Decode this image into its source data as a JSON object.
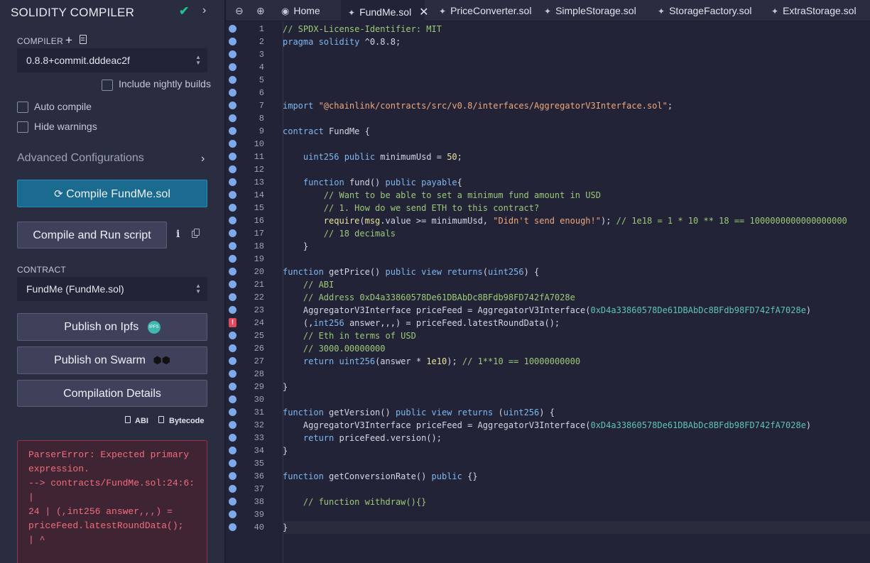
{
  "side_panel": {
    "title": "SOLIDITY COMPILER",
    "compiler_label": "COMPILER",
    "compiler_version": "0.8.8+commit.dddeac2f",
    "nightly_label": "Include nightly builds",
    "auto_compile_label": "Auto compile",
    "hide_warnings_label": "Hide warnings",
    "advanced_label": "Advanced Configurations",
    "compile_button": "Compile FundMe.sol",
    "compile_run_button": "Compile and Run script",
    "contract_label": "CONTRACT",
    "contract_value": "FundMe (FundMe.sol)",
    "publish_ipfs": "Publish on Ipfs",
    "ipfs_badge": "IPFS",
    "publish_swarm": "Publish on Swarm",
    "compilation_details": "Compilation Details",
    "abi_label": "ABI",
    "bytecode_label": "Bytecode",
    "error_lines": [
      "ParserError: Expected primary expression.",
      "--> contracts/FundMe.sol:24:6:",
      "|",
      "24 | (,int256 answer,,,) = priceFeed.latestRoundData();",
      "| ^"
    ]
  },
  "tabs": [
    {
      "label": "Home",
      "icon": "remix-icon"
    },
    {
      "label": "FundMe.sol",
      "icon": "solidity-file-icon",
      "active": true
    },
    {
      "label": "PriceConverter.sol",
      "icon": "solidity-file-icon"
    },
    {
      "label": "SimpleStorage.sol",
      "icon": "solidity-file-icon"
    },
    {
      "label": "StorageFactory.sol",
      "icon": "solidity-file-icon"
    },
    {
      "label": "ExtraStorage.sol",
      "icon": "solidity-file-icon"
    }
  ],
  "editor": {
    "error_line": 24,
    "current_line": 40,
    "lines": [
      [
        [
          "c",
          "// SPDX-License-Identifier: MIT"
        ]
      ],
      [
        [
          "k",
          "pragma solidity "
        ],
        [
          "p",
          "^0.8.8;"
        ]
      ],
      [],
      [],
      [],
      [],
      [
        [
          "k",
          "import "
        ],
        [
          "s",
          "\"@chainlink/contracts/src/v0.8/interfaces/AggregatorV3Interface.sol\""
        ],
        [
          "p",
          ";"
        ]
      ],
      [],
      [
        [
          "k",
          "contract "
        ],
        [
          "p",
          "FundMe {"
        ]
      ],
      [],
      [
        [
          "p",
          "    "
        ],
        [
          "t",
          "uint256 "
        ],
        [
          "k",
          "public "
        ],
        [
          "p",
          "minimumUsd = "
        ],
        [
          "n",
          "50"
        ],
        [
          "p",
          ";"
        ]
      ],
      [],
      [
        [
          "p",
          "    "
        ],
        [
          "k",
          "function "
        ],
        [
          "p",
          "fund() "
        ],
        [
          "k",
          "public payable"
        ],
        [
          "p",
          "{"
        ]
      ],
      [
        [
          "p",
          "        "
        ],
        [
          "c",
          "// Want to be able to set a minimum fund amount in USD"
        ]
      ],
      [
        [
          "p",
          "        "
        ],
        [
          "c",
          "// 1. How do we send ETH to this contract?"
        ]
      ],
      [
        [
          "p",
          "        "
        ],
        [
          "n",
          "require"
        ],
        [
          "p",
          "("
        ],
        [
          "n",
          "msg"
        ],
        [
          "p",
          ".value >= minimumUsd, "
        ],
        [
          "s",
          "\"Didn't send enough!\""
        ],
        [
          "p",
          "); "
        ],
        [
          "c",
          "// 1e18 = 1 * 10 ** 18 == 1000000000000000000"
        ]
      ],
      [
        [
          "p",
          "        "
        ],
        [
          "c",
          "// 18 decimals"
        ]
      ],
      [
        [
          "p",
          "    }"
        ]
      ],
      [],
      [
        [
          "k",
          "function "
        ],
        [
          "p",
          "getPrice() "
        ],
        [
          "k",
          "public view returns"
        ],
        [
          "p",
          "("
        ],
        [
          "t",
          "uint256"
        ],
        [
          "p",
          ") {"
        ]
      ],
      [
        [
          "p",
          "    "
        ],
        [
          "c",
          "// ABI"
        ]
      ],
      [
        [
          "p",
          "    "
        ],
        [
          "c",
          "// Address 0xD4a33860578De61DBAbDc8BFdb98FD742fA7028e"
        ]
      ],
      [
        [
          "p",
          "    AggregatorV3Interface priceFeed = AggregatorV3Interface("
        ],
        [
          "h",
          "0xD4a33860578De61DBAbDc8BFdb98FD742fA7028e"
        ],
        [
          "p",
          ")"
        ]
      ],
      [
        [
          "p",
          "    (,"
        ],
        [
          "t",
          "int256 "
        ],
        [
          "p",
          "answer,,,) = priceFeed.latestRoundData();"
        ]
      ],
      [
        [
          "p",
          "    "
        ],
        [
          "c",
          "// Eth in terms of USD"
        ]
      ],
      [
        [
          "p",
          "    "
        ],
        [
          "c",
          "// 3000.00000000"
        ]
      ],
      [
        [
          "p",
          "    "
        ],
        [
          "k",
          "return "
        ],
        [
          "t",
          "uint256"
        ],
        [
          "p",
          "(answer * "
        ],
        [
          "n",
          "1e10"
        ],
        [
          "p",
          "); "
        ],
        [
          "c",
          "// 1**10 == 10000000000"
        ]
      ],
      [],
      [
        [
          "p",
          "}"
        ]
      ],
      [],
      [
        [
          "k",
          "function "
        ],
        [
          "p",
          "getVersion() "
        ],
        [
          "k",
          "public view returns "
        ],
        [
          "p",
          "("
        ],
        [
          "t",
          "uint256"
        ],
        [
          "p",
          ") {"
        ]
      ],
      [
        [
          "p",
          "    AggregatorV3Interface priceFeed = AggregatorV3Interface("
        ],
        [
          "h",
          "0xD4a33860578De61DBAbDc8BFdb98FD742fA7028e"
        ],
        [
          "p",
          ")"
        ]
      ],
      [
        [
          "p",
          "    "
        ],
        [
          "k",
          "return "
        ],
        [
          "p",
          "priceFeed.version();"
        ]
      ],
      [
        [
          "p",
          "}"
        ]
      ],
      [],
      [
        [
          "k",
          "function "
        ],
        [
          "p",
          "getConversionRate() "
        ],
        [
          "k",
          "public "
        ],
        [
          "p",
          "{}"
        ]
      ],
      [],
      [
        [
          "p",
          "    "
        ],
        [
          "c",
          "// function withdraw(){}"
        ]
      ],
      [],
      [
        [
          "p",
          "}"
        ]
      ]
    ]
  }
}
